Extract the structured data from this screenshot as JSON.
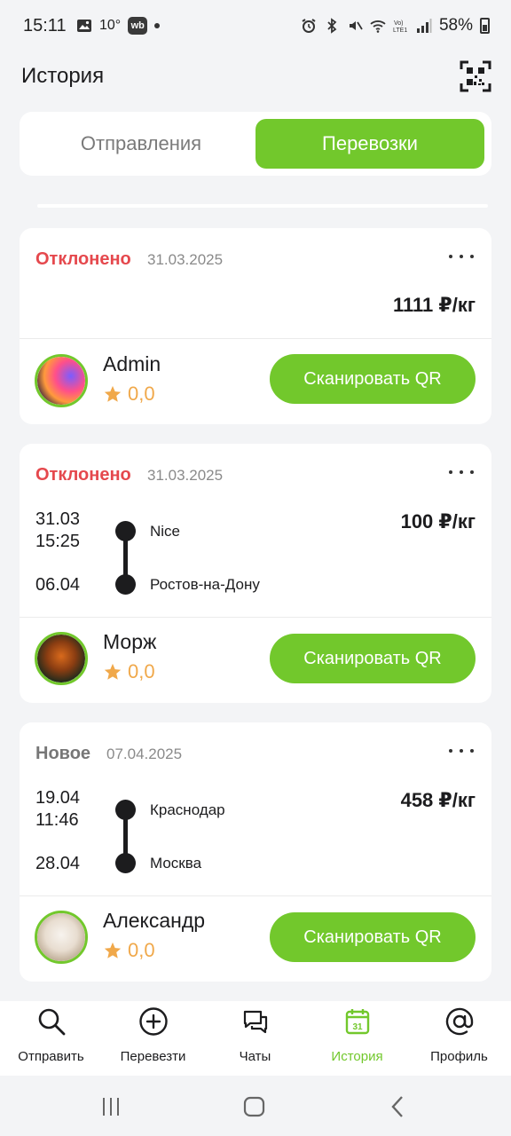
{
  "status_bar": {
    "time": "15:11",
    "temperature": "10°",
    "wb_badge": "wb",
    "battery": "58%"
  },
  "header": {
    "title": "История"
  },
  "tabs": {
    "items": [
      {
        "label": "Отправления",
        "active": false
      },
      {
        "label": "Перевозки",
        "active": true
      }
    ]
  },
  "cards": [
    {
      "status": "Отклонено",
      "date": "31.03.2025",
      "price": "1111 ₽/кг",
      "user": {
        "name": "Admin",
        "rating": "0,0"
      },
      "action": "Сканировать QR"
    },
    {
      "status": "Отклонено",
      "date": "31.03.2025",
      "price": "100 ₽/кг",
      "route": {
        "from": {
          "date": "31.03",
          "time": "15:25",
          "city": "Nice"
        },
        "to": {
          "date": "06.04",
          "city": "Ростов-на-Дону"
        }
      },
      "user": {
        "name": "Морж",
        "rating": "0,0"
      },
      "action": "Сканировать QR"
    },
    {
      "status": "Новое",
      "date": "07.04.2025",
      "price": "458 ₽/кг",
      "route": {
        "from": {
          "date": "19.04",
          "time": "11:46",
          "city": "Краснодар"
        },
        "to": {
          "date": "28.04",
          "city": "Москва"
        }
      },
      "user": {
        "name": "Александр",
        "rating": "0,0"
      },
      "action": "Сканировать QR"
    }
  ],
  "bottom_nav": [
    {
      "label": "Отправить",
      "icon": "search-icon"
    },
    {
      "label": "Перевезти",
      "icon": "plus-circle-icon"
    },
    {
      "label": "Чаты",
      "icon": "chat-icon"
    },
    {
      "label": "История",
      "icon": "calendar-icon",
      "active": true,
      "calendar_day": "31"
    },
    {
      "label": "Профиль",
      "icon": "at-icon"
    }
  ],
  "colors": {
    "accent": "#72c82c",
    "rejected": "#e5484d",
    "rating": "#f0a84a",
    "background": "#f3f4f6"
  }
}
